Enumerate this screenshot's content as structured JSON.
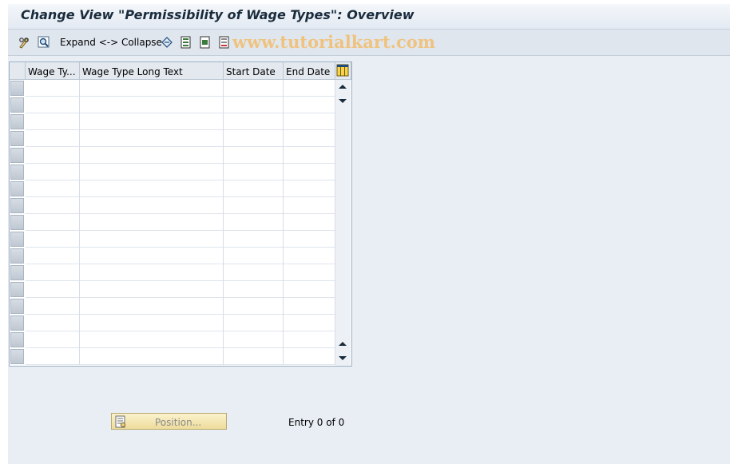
{
  "window": {
    "title": "Change View \"Permissibility of Wage Types\": Overview"
  },
  "toolbar": {
    "items": [
      {
        "icon": "display-change-icon"
      },
      {
        "icon": "find-icon"
      },
      {
        "label": "Expand <-> Collapse"
      },
      {
        "icon": "undo-icon"
      },
      {
        "icon": "select-all-icon"
      },
      {
        "icon": "select-block-icon"
      },
      {
        "icon": "deselect-all-icon"
      }
    ],
    "watermark": "www.tutorialkart.com"
  },
  "table": {
    "columns": [
      "Wage Ty...",
      "Wage Type Long Text",
      "Start Date",
      "End Date"
    ],
    "settings_icon": "table-settings-icon",
    "row_count": 17,
    "rows": []
  },
  "footer": {
    "position_button_label": "Position...",
    "entry_text": "Entry 0 of 0"
  },
  "colors": {
    "background": "#e9eef5",
    "title": "#1a2b3c",
    "button": "#f3e6b0",
    "watermark": "#f0c27a"
  }
}
